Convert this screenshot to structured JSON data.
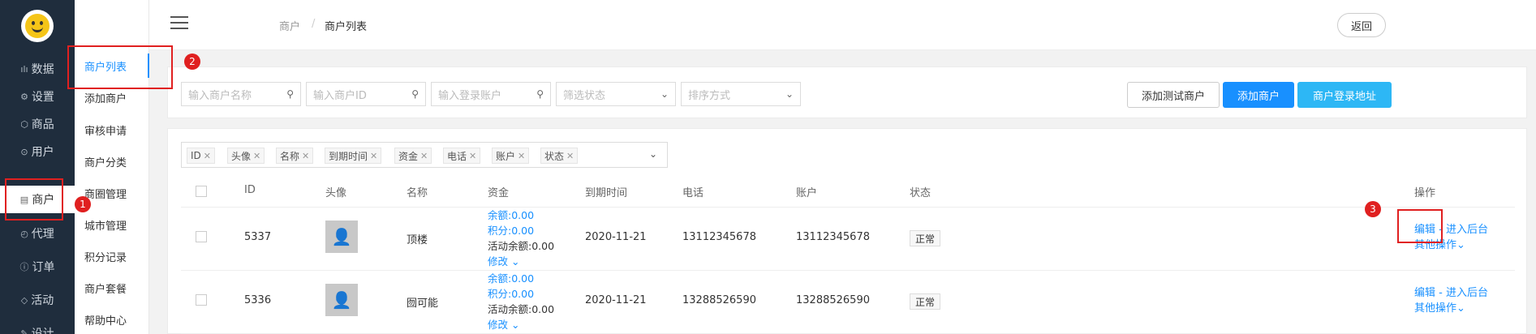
{
  "nav": {
    "items": [
      {
        "icon": "chart-icon",
        "glyph": "ılı",
        "label": "数据"
      },
      {
        "icon": "gear-icon",
        "glyph": "⚙",
        "label": "设置"
      },
      {
        "icon": "box-icon",
        "glyph": "⬡",
        "label": "商品"
      },
      {
        "icon": "user-icon",
        "glyph": "⊙",
        "label": "用户"
      },
      {
        "icon": "store-icon",
        "glyph": "▤",
        "label": "商户"
      },
      {
        "icon": "clock-icon",
        "glyph": "◴",
        "label": "代理"
      },
      {
        "icon": "info-icon",
        "glyph": "ⓘ",
        "label": "订单"
      },
      {
        "icon": "tag-icon",
        "glyph": "◇",
        "label": "活动"
      },
      {
        "icon": "design-icon",
        "glyph": "✎",
        "label": "设计"
      }
    ]
  },
  "submenu": {
    "items": [
      "商户列表",
      "添加商户",
      "审核申请",
      "商户分类",
      "商圈管理",
      "城市管理",
      "积分记录",
      "商户套餐",
      "帮助中心"
    ]
  },
  "header": {
    "crumb_parent": "商户",
    "crumb_sep": "/",
    "crumb_current": "商户列表",
    "back_label": "返回"
  },
  "toolbar": {
    "name_placeholder": "输入商户名称",
    "id_placeholder": "输入商户ID",
    "account_placeholder": "输入登录账户",
    "status_placeholder": "筛选状态",
    "sort_placeholder": "排序方式",
    "add_test_label": "添加测试商户",
    "add_label": "添加商户",
    "login_url_label": "商户登录地址"
  },
  "columns_selected": [
    "ID",
    "头像",
    "名称",
    "到期时间",
    "资金",
    "电话",
    "账户",
    "状态"
  ],
  "table": {
    "headers": {
      "id": "ID",
      "avatar": "头像",
      "name": "名称",
      "funds": "资金",
      "expire": "到期时间",
      "phone": "电话",
      "account": "账户",
      "status": "状态",
      "ops": "操作"
    },
    "rows": [
      {
        "id": "5337",
        "name": "顶楼",
        "balance": "余额:0.00",
        "points": "积分:0.00",
        "activity": "活动余额:0.00",
        "modify": "修改",
        "expire": "2020-11-21",
        "phone": "13112345678",
        "account": "13112345678",
        "status": "正常",
        "edit": "编辑",
        "sep": " - ",
        "enter": "进入后台",
        "more": "其他操作"
      },
      {
        "id": "5336",
        "name": "囫可能",
        "balance": "余额:0.00",
        "points": "积分:0.00",
        "activity": "活动余额:0.00",
        "modify": "修改",
        "expire": "2020-11-21",
        "phone": "13288526590",
        "account": "13288526590",
        "status": "正常",
        "edit": "编辑",
        "sep": " - ",
        "enter": "进入后台",
        "more": "其他操作"
      }
    ]
  },
  "annotations": [
    "1",
    "2",
    "3"
  ],
  "colors": {
    "accent": "#1890ff",
    "nav_bg": "#1f2d3d",
    "annotation": "#e02020"
  }
}
